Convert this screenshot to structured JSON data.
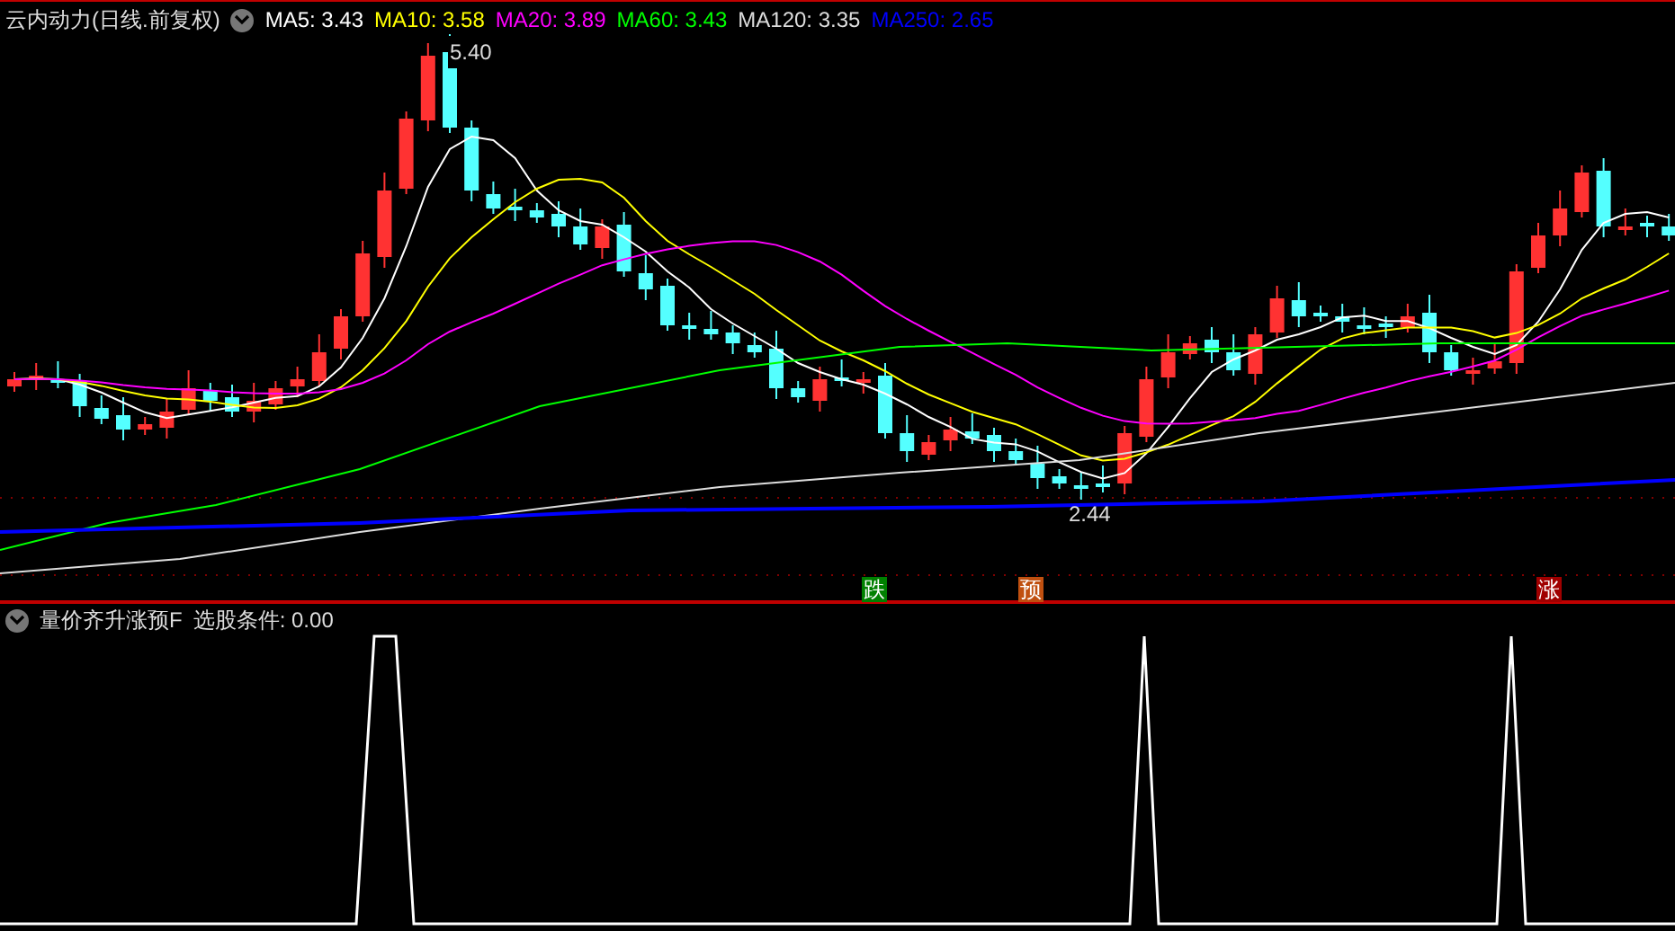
{
  "main_panel": {
    "title": "云内动力(日线.前复权)",
    "moving_averages": [
      {
        "label": "MA5: 3.43",
        "color": "#ffffff"
      },
      {
        "label": "MA10: 3.58",
        "color": "#ffff00"
      },
      {
        "label": "MA20: 3.89",
        "color": "#ff00ff"
      },
      {
        "label": "MA60: 3.43",
        "color": "#00ff00"
      },
      {
        "label": "MA120: 3.35",
        "color": "#dddddd"
      },
      {
        "label": "MA250: 2.65",
        "color": "#0000ff"
      }
    ],
    "high_label": "5.40",
    "low_label": "2.44",
    "signals": [
      {
        "text": "跌",
        "color": "#008000"
      },
      {
        "text": "预",
        "color": "#c05010"
      },
      {
        "text": "涨",
        "color": "#a00000"
      }
    ]
  },
  "indicator_panel": {
    "title": "量价齐升涨预F",
    "condition": "选股条件: 0.00"
  }
}
